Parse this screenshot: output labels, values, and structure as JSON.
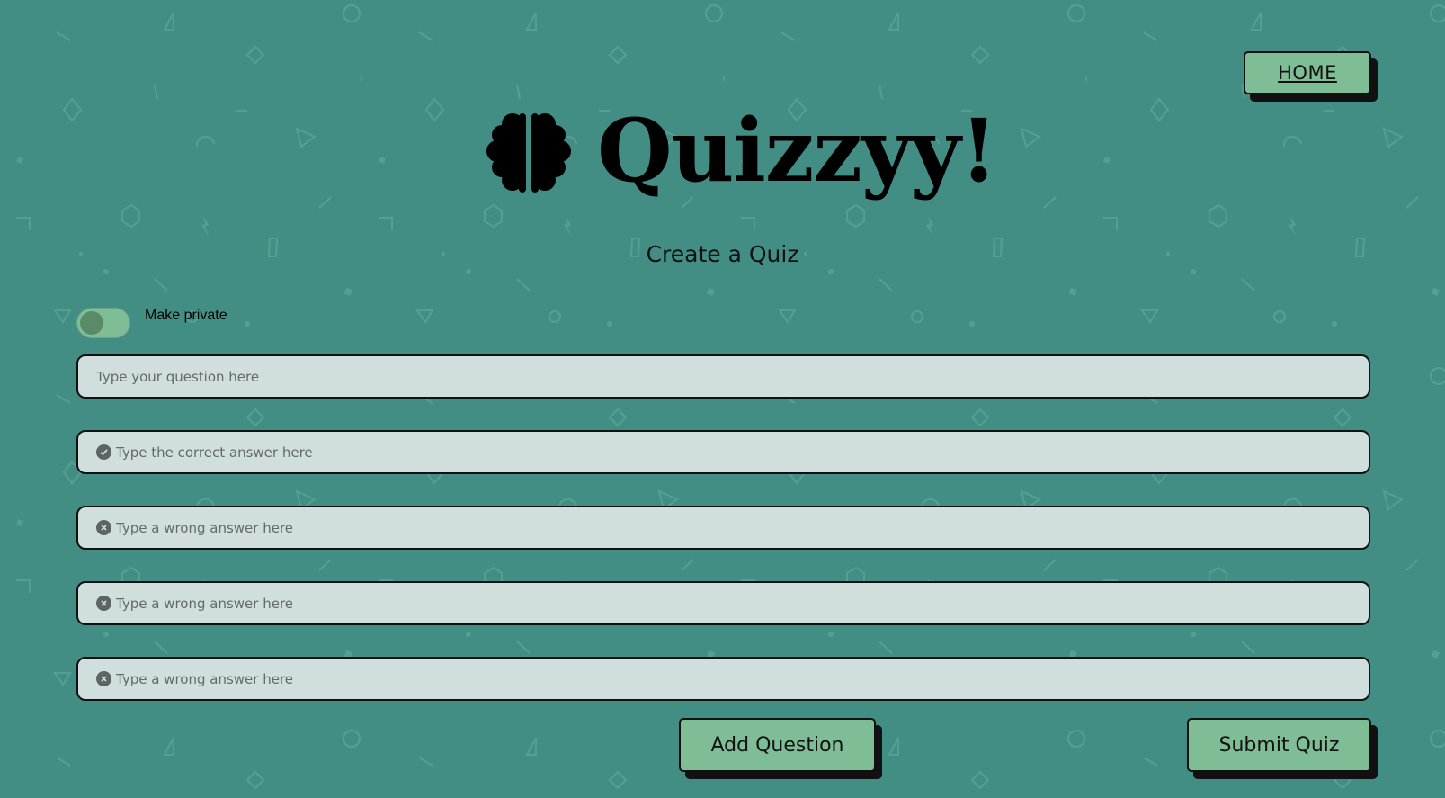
{
  "nav": {
    "home_label": "HOME"
  },
  "header": {
    "app_title": "Quizzyy!",
    "logo_icon": "brain-icon",
    "subtitle": "Create a Quiz"
  },
  "privacy": {
    "label": "Make private",
    "checked": false
  },
  "form": {
    "question_placeholder": "Type your question here",
    "correct_answer_placeholder": "Type the correct answer here",
    "wrong_answers": [
      {
        "placeholder": "Type a wrong answer here",
        "icon": "x-circle-icon"
      },
      {
        "placeholder": "Type a wrong answer here",
        "icon": "x-circle-icon"
      },
      {
        "placeholder": "Type a wrong answer here",
        "icon": "x-circle-icon"
      }
    ],
    "correct_icon": "check-circle-icon"
  },
  "actions": {
    "add_question_label": "Add Question",
    "submit_label": "Submit Quiz"
  },
  "colors": {
    "background": "#438e84",
    "button": "#7fbd97",
    "field": "#d0dfdd",
    "shadow": "#111111"
  }
}
